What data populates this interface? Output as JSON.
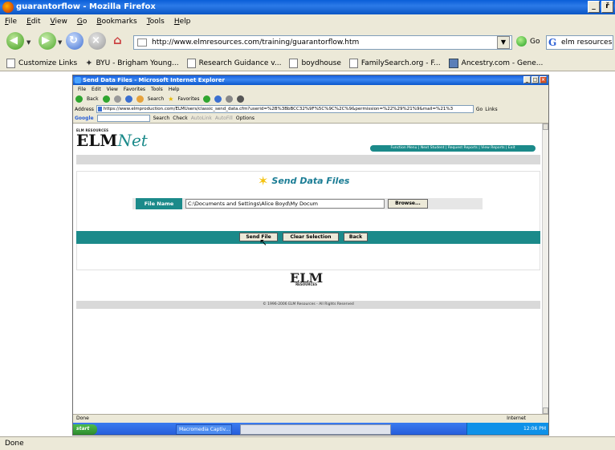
{
  "firefox": {
    "title": "guarantorflow - Mozilla Firefox",
    "window_buttons": [
      "_",
      "ř",
      "×"
    ],
    "menu": [
      "File",
      "Edit",
      "View",
      "Go",
      "Bookmarks",
      "Tools",
      "Help"
    ],
    "url": "http://www.elmresources.com/training/guarantorflow.htm",
    "go_label": "Go",
    "search_value": "elm resources",
    "bookmarks": [
      {
        "label": "Customize Links",
        "icon": "page-icon"
      },
      {
        "label": "BYU - Brigham Young...",
        "icon": "byu-icon"
      },
      {
        "label": "Research Guidance v...",
        "icon": "page-icon"
      },
      {
        "label": "boydhouse",
        "icon": "page-icon"
      },
      {
        "label": "FamilySearch.org - F...",
        "icon": "page-icon"
      },
      {
        "label": "Ancestry.com - Gene...",
        "icon": "ancestry-icon"
      }
    ],
    "status": "Done"
  },
  "ie": {
    "title": "Send Data Files - Microsoft Internet Explorer",
    "menu": [
      "File",
      "Edit",
      "View",
      "Favorites",
      "Tools",
      "Help"
    ],
    "toolbar": [
      "Back",
      "Search",
      "Favorites"
    ],
    "address_label": "Address",
    "address": "https://www.elmproduction.com/ELMUsers/classic_send_data.cfm?userid=%2B%3BbBCC32%9F%5C%9C%2C%9&permission=%22%29%21%9&mail=%21%3",
    "go_label": "Go",
    "links_label": "Links",
    "google_label": "Google",
    "google_items": [
      "Search",
      "Check",
      "AutoLink",
      "AutoFill",
      "Options"
    ],
    "status": "Done",
    "zone": "Internet",
    "taskbar": {
      "start": "start",
      "task": "Macromedia Captiv...",
      "clock": "12:06 PM"
    }
  },
  "page": {
    "logo_small": "ELM RESOURCES",
    "logo_elm": "ELM",
    "logo_net": "Net",
    "nav": "Function Menu | Next Student | Request Reports | View Reports | Exit",
    "heading": "Send Data Files",
    "file_label": "File Name",
    "file_value": "C:\\Documents and Settings\\Alice Boyd\\My Docum",
    "browse": "Browse...",
    "send_file": "Send File",
    "clear_selection": "Clear Selection",
    "back": "Back",
    "footer_logo": "ELM",
    "footer_logo_sub": "RESOURCES",
    "copyright": "© 1996-2006 ELM Resources - All Rights Reserved"
  }
}
